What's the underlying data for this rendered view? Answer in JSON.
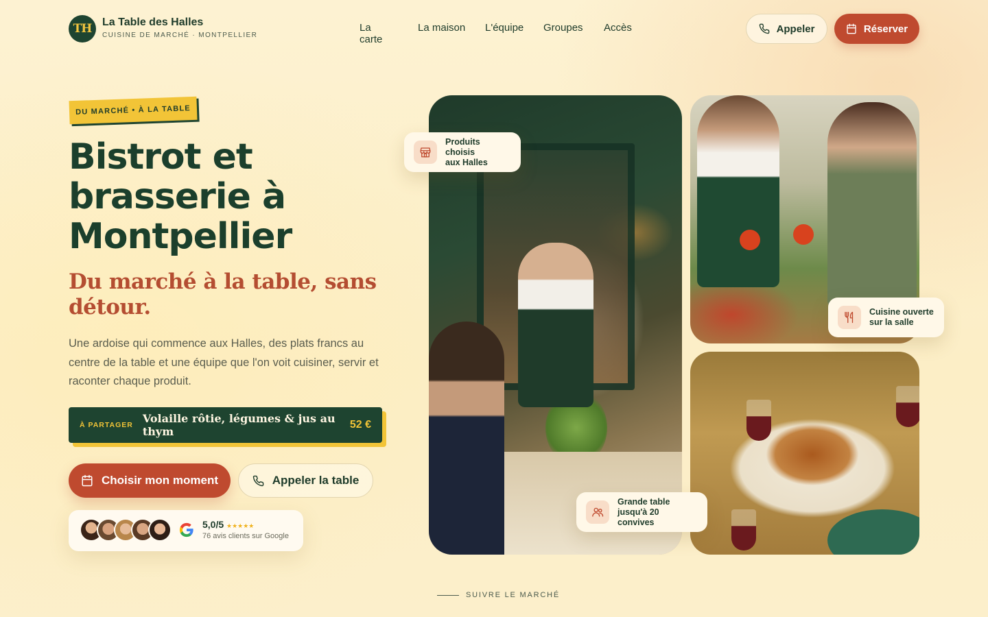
{
  "brand": {
    "monogram": "TH",
    "name": "La Table des Halles",
    "tagline": "CUISINE DE MARCHÉ · MONTPELLIER"
  },
  "nav": {
    "items": [
      "La carte",
      "La maison",
      "L'équipe",
      "Groupes",
      "Accès"
    ]
  },
  "header_actions": {
    "call_label": "Appeler",
    "book_label": "Réserver"
  },
  "hero": {
    "tag": "DU MARCHÉ • À LA TABLE",
    "title_lines": [
      "Bistrot et",
      "brasserie à",
      "Montpellier"
    ],
    "subtitle": "Du marché à la table, sans détour.",
    "lead": "Une ardoise qui commence aux Halles, des plats francs au centre de la table et une équipe que l'on voit cuisiner, servir et raconter chaque produit.",
    "dish": {
      "tag": "À PARTAGER",
      "name": "Volaille rôtie, légumes & jus au thym",
      "price": "52 €"
    },
    "cta_primary": "Choisir mon moment",
    "cta_secondary": "Appeler la table",
    "reviews": {
      "score": "5,0/5",
      "stars": "★★★★★",
      "count_text": "76 avis clients sur Google"
    }
  },
  "gallery_chips": {
    "produce": [
      "Produits choisis",
      "aux Halles"
    ],
    "kitchen": [
      "Cuisine ouverte",
      "sur la salle"
    ],
    "groups": [
      "Grande table",
      "jusqu'à 20 convives"
    ]
  },
  "scroll_cue": "SUIVRE LE MARCHÉ",
  "colors": {
    "background": "#fdf1cc",
    "forest_green": "#1e4430",
    "brick_red": "#bf4a2f",
    "mustard": "#f2c437"
  },
  "icons": {
    "phone": "phone-icon",
    "calendar": "calendar-icon",
    "store": "market-stall-icon",
    "utensils": "fork-knife-icon",
    "people": "people-icon",
    "google": "google-logo-icon"
  }
}
